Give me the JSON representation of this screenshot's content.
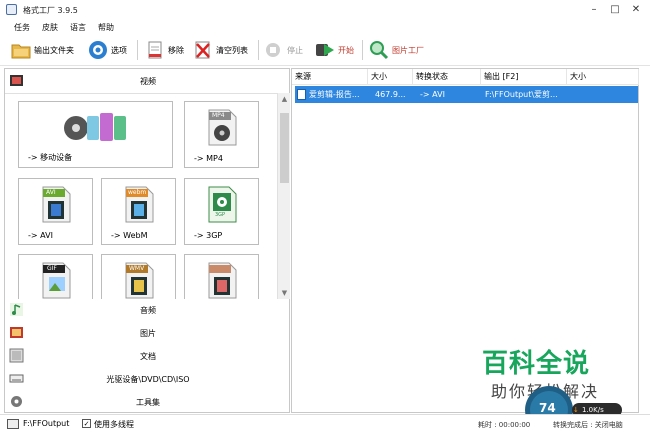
{
  "window": {
    "title": "格式工厂 3.9.5"
  },
  "menu": [
    "任务",
    "皮肤",
    "语言",
    "帮助"
  ],
  "toolbar": {
    "output_folder": "输出文件夹",
    "options": "选项",
    "remove": "移除",
    "clear_list": "清空列表",
    "stop": "停止",
    "start": "开始",
    "picture_factory": "图片工厂"
  },
  "categories": {
    "video": "视频",
    "audio": "音频",
    "picture": "图片",
    "document": "文档",
    "optical": "光驱设备\\DVD\\CD\\ISO",
    "toolbox": "工具集"
  },
  "tiles": [
    {
      "label": "-> 移动设备"
    },
    {
      "label": "-> MP4",
      "badge": "MP4"
    },
    {
      "label": "-> AVI",
      "badge": "AVI"
    },
    {
      "label": "-> WebM",
      "badge": "webm"
    },
    {
      "label": "-> 3GP",
      "badge": "3GP"
    },
    {
      "label": "",
      "badge": "GIF"
    },
    {
      "label": "",
      "badge": "WMV"
    },
    {
      "label": "",
      "badge": ""
    }
  ],
  "task_table": {
    "columns": [
      "来源",
      "大小",
      "转换状态",
      "输出 [F2]",
      "大小"
    ],
    "rows": [
      {
        "source": "爱剪辑-报告...",
        "size": "467.9...",
        "status": "-> AVI",
        "output": "F:\\FFOutput\\爱剪...",
        "out_size": ""
      }
    ]
  },
  "status": {
    "output_path": "F:\\FFOutput",
    "multithread_label": "使用多线程",
    "multithread_checked": true,
    "elapsed_label": "耗时 : 00:00:00",
    "after_label": "转换完成后 : 关闭电脑"
  },
  "watermark": {
    "main": "百科全说",
    "sub": "助你轻松解决"
  },
  "speed_widget": {
    "percent": "74",
    "rate": "1.0K/s"
  },
  "colors": {
    "selection": "#2e86de",
    "watermark_green": "#17a65b"
  }
}
